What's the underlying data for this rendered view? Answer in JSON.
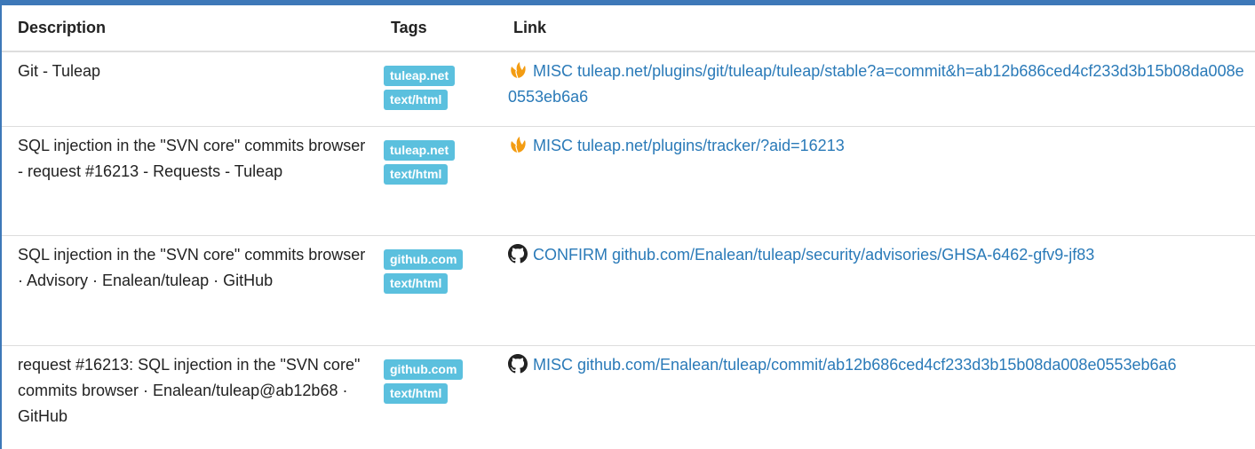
{
  "table": {
    "headers": [
      "Description",
      "Tags",
      "Link"
    ],
    "rows": [
      {
        "description": "Git - Tuleap",
        "tags": [
          "tuleap.net",
          "text/html"
        ],
        "icon": "tuleap-icon",
        "link_text": "MISC tuleap.net/plugins/git/tuleap/tuleap/stable?a=commit&h=ab12b686ced4cf233d3b15b08da008e0553eb6a6"
      },
      {
        "description": "SQL injection in the \"SVN core\" commits browser - request #16213 - Requests - Tuleap",
        "tags": [
          "tuleap.net",
          "text/html"
        ],
        "icon": "tuleap-icon",
        "link_text": "MISC tuleap.net/plugins/tracker/?aid=16213"
      },
      {
        "description": "SQL injection in the \"SVN core\" commits browser · Advisory · Enalean/tuleap · GitHub",
        "tags": [
          "github.com",
          "text/html"
        ],
        "icon": "github-icon",
        "link_text": "CONFIRM github.com/Enalean/tuleap/security/advisories/GHSA-6462-gfv9-jf83"
      },
      {
        "description": "request #16213: SQL injection in the \"SVN core\" commits browser · Enalean/tuleap@ab12b68 · GitHub",
        "tags": [
          "github.com",
          "text/html"
        ],
        "icon": "github-icon",
        "link_text": "MISC github.com/Enalean/tuleap/commit/ab12b686ced4cf233d3b15b08da008e0553eb6a6"
      }
    ]
  },
  "colors": {
    "frame_border": "#3d78b8",
    "tag_background": "#5bc0de",
    "link": "#2a7ab8",
    "tuleap_icon": "#f39c12"
  }
}
